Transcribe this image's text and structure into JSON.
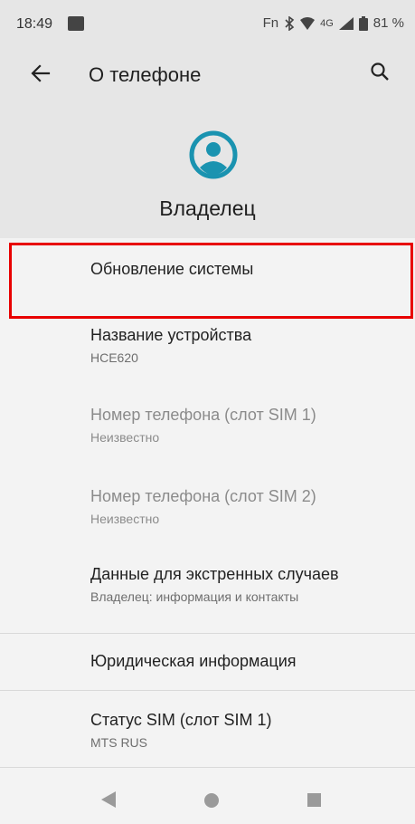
{
  "status_bar": {
    "time": "18:49",
    "fn_label": "Fn",
    "network": "4G",
    "battery": "81 %"
  },
  "header": {
    "title": "О телефоне",
    "owner_name": "Владелец"
  },
  "list": {
    "items": [
      {
        "label": "Обновление системы",
        "sub": ""
      },
      {
        "label": "Название устройства",
        "sub": "HCE620"
      },
      {
        "label": "Номер телефона (слот SIM 1)",
        "sub": "Неизвестно"
      },
      {
        "label": "Номер телефона (слот SIM 2)",
        "sub": "Неизвестно"
      },
      {
        "label": "Данные для экстренных случаев",
        "sub": "Владелец: информация и контакты"
      },
      {
        "label": "Юридическая информация",
        "sub": ""
      },
      {
        "label": "Статус SIM (слот SIM 1)",
        "sub": "MTS RUS"
      }
    ]
  },
  "colors": {
    "accent": "#1a93b0",
    "highlight": "#e80000",
    "header_bg": "#e6e6e6",
    "list_bg": "#f3f3f3"
  },
  "icons": {
    "back": "arrow-left-icon",
    "search": "search-icon",
    "avatar": "account-circle-icon",
    "bluetooth": "bluetooth-icon",
    "signal": "signal-icon",
    "battery": "battery-icon"
  }
}
